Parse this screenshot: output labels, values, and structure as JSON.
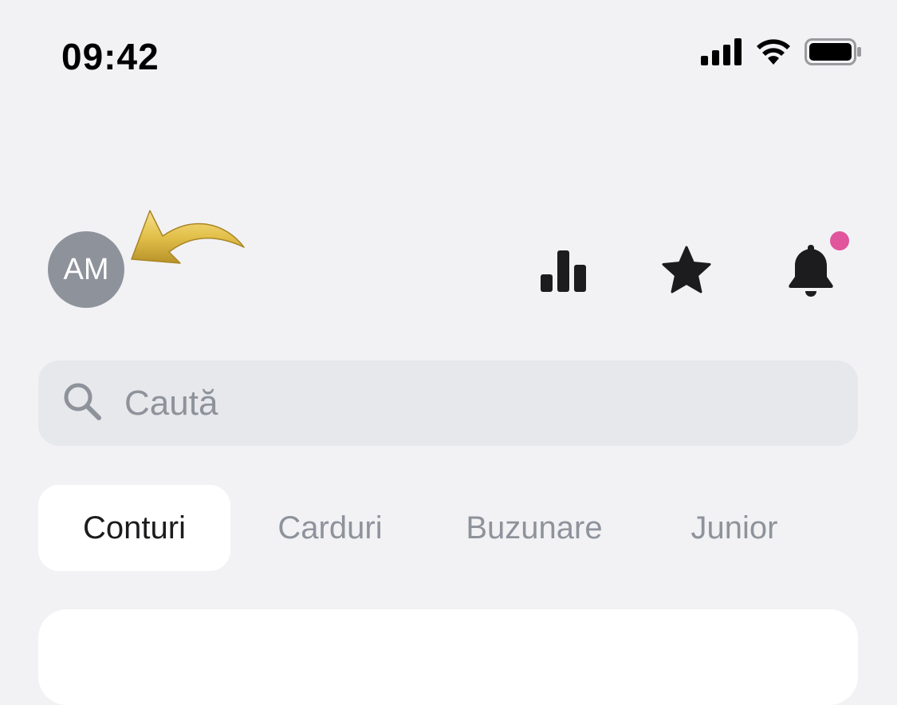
{
  "status_bar": {
    "time": "09:42",
    "icons": [
      "cellular-signal-icon",
      "wifi-icon",
      "battery-icon"
    ]
  },
  "header": {
    "avatar_initials": "AM",
    "avatar_color": "#8e939b",
    "actions": [
      "stats-icon",
      "star-icon",
      "bell-icon"
    ],
    "has_notification": true,
    "notification_color": "#e0559c"
  },
  "search": {
    "placeholder": "Caută"
  },
  "tabs": [
    {
      "label": "Conturi",
      "active": true
    },
    {
      "label": "Carduri",
      "active": false
    },
    {
      "label": "Buzunare",
      "active": false
    },
    {
      "label": "Junior",
      "active": false
    }
  ],
  "colors": {
    "background": "#f2f2f5",
    "search_bg": "#e7e8ec",
    "muted_text": "#8e939b",
    "arrow": "#d9b53c"
  }
}
